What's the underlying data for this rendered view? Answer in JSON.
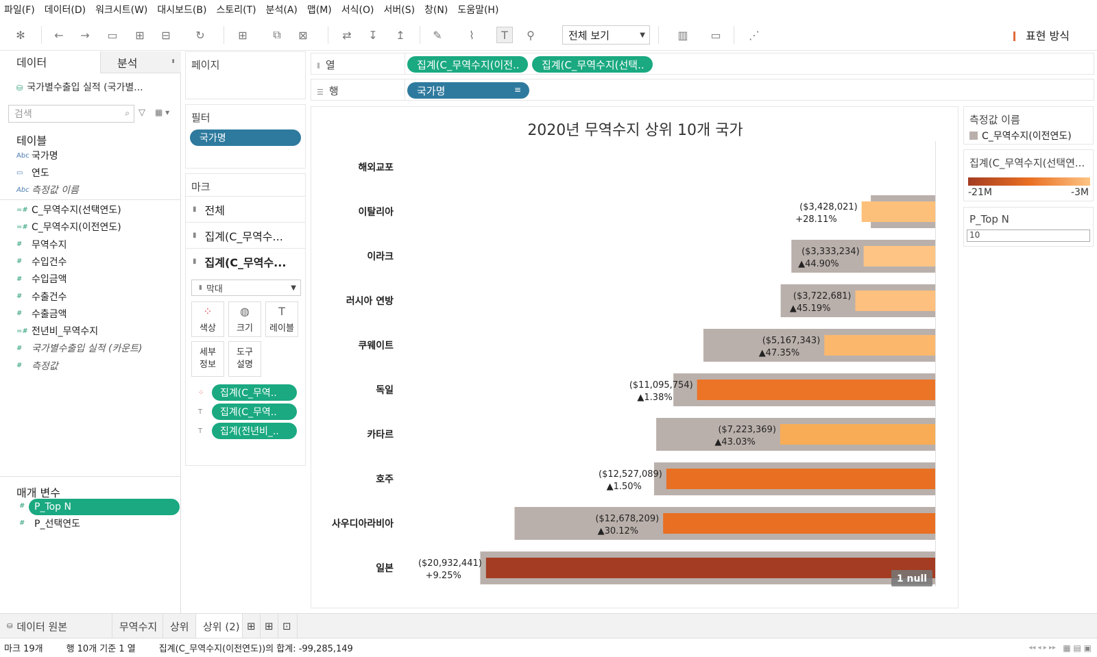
{
  "menu": [
    "파일(F)",
    "데이터(D)",
    "워크시트(W)",
    "대시보드(B)",
    "스토리(T)",
    "분석(A)",
    "맵(M)",
    "서식(O)",
    "서버(S)",
    "창(N)",
    "도움말(H)"
  ],
  "toolbar": {
    "view_select": "전체 보기",
    "show_me": "표현 방식"
  },
  "left": {
    "tab_data": "데이터",
    "tab_analysis": "분석",
    "datasource": "국가별수출입 실적 (국가별...",
    "search_placeholder": "검색",
    "tables_header": "테이블",
    "dimensions": [
      {
        "icon": "Abc",
        "label": "국가명"
      },
      {
        "icon": "▭",
        "label": "연도"
      },
      {
        "icon": "Abc",
        "label": "측정값 이름"
      }
    ],
    "measures": [
      {
        "icon": "=#",
        "label": "C_무역수지(선택연도)"
      },
      {
        "icon": "=#",
        "label": "C_무역수지(이전연도)"
      },
      {
        "icon": "#",
        "label": "무역수지"
      },
      {
        "icon": "#",
        "label": "수입건수"
      },
      {
        "icon": "#",
        "label": "수입금액"
      },
      {
        "icon": "#",
        "label": "수출건수"
      },
      {
        "icon": "#",
        "label": "수출금액"
      },
      {
        "icon": "=#",
        "label": "전년비_무역수지"
      },
      {
        "icon": "#",
        "label": "국가별수출입 실적 (카운트)"
      },
      {
        "icon": "#",
        "label": "측정값"
      }
    ],
    "params_header": "매개 변수",
    "params": [
      "P_Top N",
      "P_선택연도"
    ]
  },
  "shelves": {
    "pages": "페이지",
    "filters": "필터",
    "filter_pill": "국가명",
    "marks": "마크",
    "marks_rows": [
      "전체",
      "집계(C_무역수...",
      "집계(C_무역수..."
    ],
    "mark_type": "막대",
    "mark_buttons": [
      "색상",
      "크기",
      "레이블",
      "세부\n정보",
      "도구\n설명"
    ],
    "mark_pills": [
      "집계(C_무역..",
      "집계(C_무역..",
      "집계(전년비_.."
    ],
    "columns": "열",
    "columns_pills": [
      "집계(C_무역수지(이전..",
      "집계(C_무역수지(선택.."
    ],
    "rows": "행",
    "rows_pill": "국가명"
  },
  "legend": {
    "measure_names_title": "측정값 이름",
    "measure_names_item": "C_무역수지(이전연도)",
    "color_title": "집계(C_무역수지(선택연...",
    "color_min": "-21M",
    "color_max": "-3M",
    "topn_title": "P_Top N",
    "topn_value": "10"
  },
  "chart_data": {
    "type": "bar",
    "title": "2020년 무역수지 상위 10개 국가",
    "categories": [
      "해외교포",
      "이탈리아",
      "이라크",
      "러시아 연방",
      "쿠웨이트",
      "독일",
      "카타르",
      "호주",
      "사우디아라비아",
      "일본"
    ],
    "series": [
      {
        "name": "C_무역수지(이전연도)",
        "values": [
          null,
          3.0,
          6.7,
          7.2,
          10.8,
          12.2,
          13.0,
          13.1,
          19.6,
          21.2
        ]
      },
      {
        "values": [
          null,
          3.428,
          3.333,
          3.723,
          5.167,
          11.096,
          7.223,
          12.527,
          12.678,
          20.932
        ]
      }
    ],
    "labels": [
      {
        "value": "",
        "change": ""
      },
      {
        "value": "($3,428,021)",
        "change": "+28.11%"
      },
      {
        "value": "($3,333,234)",
        "change": "▲44.90%"
      },
      {
        "value": "($3,722,681)",
        "change": "▲45.19%"
      },
      {
        "value": "($5,167,343)",
        "change": "▲47.35%"
      },
      {
        "value": "($11,095,754)",
        "change": "▲1.38%"
      },
      {
        "value": "($7,223,369)",
        "change": "▲43.03%"
      },
      {
        "value": "($12,527,089)",
        "change": "▲1.50%"
      },
      {
        "value": "($12,678,209)",
        "change": "▲30.12%"
      },
      {
        "value": "($20,932,441)",
        "change": "+9.25%"
      }
    ],
    "colors": [
      "#ffffff",
      "#fdc07a",
      "#fdc484",
      "#fdc07e",
      "#fbb86d",
      "#ec7427",
      "#f8ac55",
      "#e96f22",
      "#e96f22",
      "#a33c22"
    ],
    "prior_color": "#bab0ab",
    "null_indicator": "1 null"
  },
  "sheet_tabs": [
    "데이터 원본",
    "무역수지",
    "상위",
    "상위 (2)"
  ],
  "status": {
    "marks": "마크 19개",
    "rows": "행 10개 기준 1 열",
    "sum": "집계(C_무역수지(이전연도))의 합계: -99,285,149"
  }
}
